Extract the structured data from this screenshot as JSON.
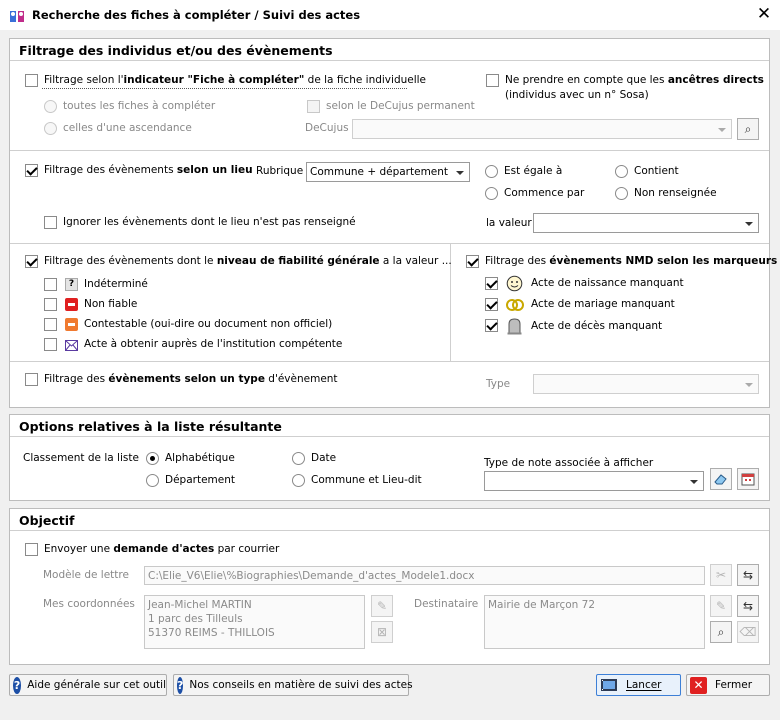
{
  "window": {
    "title": "Recherche des fiches à compléter / Suivi des actes",
    "close": "✕"
  },
  "filter_section": {
    "title": "Filtrage des individus et/ou des évènements",
    "fiche_filter": {
      "pre": "Filtrage selon l'",
      "bold": "indicateur \"Fiche à compléter\"",
      "post": " de la fiche individuelle",
      "checked": false
    },
    "opt_all": "toutes les fiches à compléter",
    "opt_asc": "celles d'une ascendance",
    "opt_decujus": "selon le DeCujus permanent",
    "decujus_label": "DeCujus",
    "direct": {
      "pre": "Ne prendre en compte que les ",
      "bold": "ancêtres directs",
      "line2": "(individus avec un n° Sosa)",
      "checked": false
    },
    "lieu": {
      "pre": "Filtrage des évènements ",
      "bold": "selon un lieu",
      "checked": true
    },
    "rubrique_label": "Rubrique",
    "rubrique_value": "Commune + département",
    "lieu_opts": [
      "Est égale à",
      "Contient",
      "Commence par",
      "Non renseignée"
    ],
    "ignore_lieu": "Ignorer les évènements dont le lieu n'est pas renseigné",
    "valeur_label": "la valeur",
    "fiab": {
      "pre": "Filtrage des évènements dont le ",
      "bold": "niveau de fiabilité générale",
      "post": " a la valeur ...",
      "checked": true
    },
    "fiab_opts": [
      "Indéterminé",
      "Non fiable",
      "Contestable (oui-dire ou document non officiel)",
      "Acte à obtenir auprès de l'institution compétente"
    ],
    "nmd": {
      "pre": "Filtrage des ",
      "bold": "évènements NMD selon les marqueurs",
      "checked": true
    },
    "nmd_opts": [
      "Acte de naissance manquant",
      "Acte de mariage manquant",
      "Acte de décès manquant"
    ],
    "type_filter": {
      "pre": "Filtrage des ",
      "bold": "évènements selon un type",
      "post": " d'évènement",
      "checked": false
    },
    "type_label": "Type"
  },
  "options_section": {
    "title": "Options relatives à la liste résultante",
    "sort_label": "Classement de la liste",
    "sort_opts": [
      "Alphabétique",
      "Date",
      "Département",
      "Commune et Lieu-dit"
    ],
    "note_label": "Type de note associée à afficher"
  },
  "objectif_section": {
    "title": "Objectif",
    "send": {
      "pre": "Envoyer une ",
      "bold": "demande d'actes",
      "post": " par courrier",
      "checked": false
    },
    "modele_label": "Modèle de lettre",
    "modele_value": "C:\\Elie_V6\\Elie\\%Biographies\\Demande_d'actes_Modele1.docx",
    "coord_label": "Mes coordonnées",
    "coord_value": "Jean-Michel MARTIN\n1 parc des Tilleuls\n51370 REIMS - THILLOIS",
    "dest_label": "Destinataire",
    "dest_value": "Mairie de Marçon 72"
  },
  "footer": {
    "help1": "Aide générale sur cet outil",
    "help2": "Nos conseils en matière de suivi des actes",
    "cancel": "Lancer",
    "close": "Fermer"
  },
  "colors": {
    "accent": "#1d4fa6",
    "red": "#e02020",
    "orange": "#f07a30",
    "purple": "#5a3aa0"
  }
}
